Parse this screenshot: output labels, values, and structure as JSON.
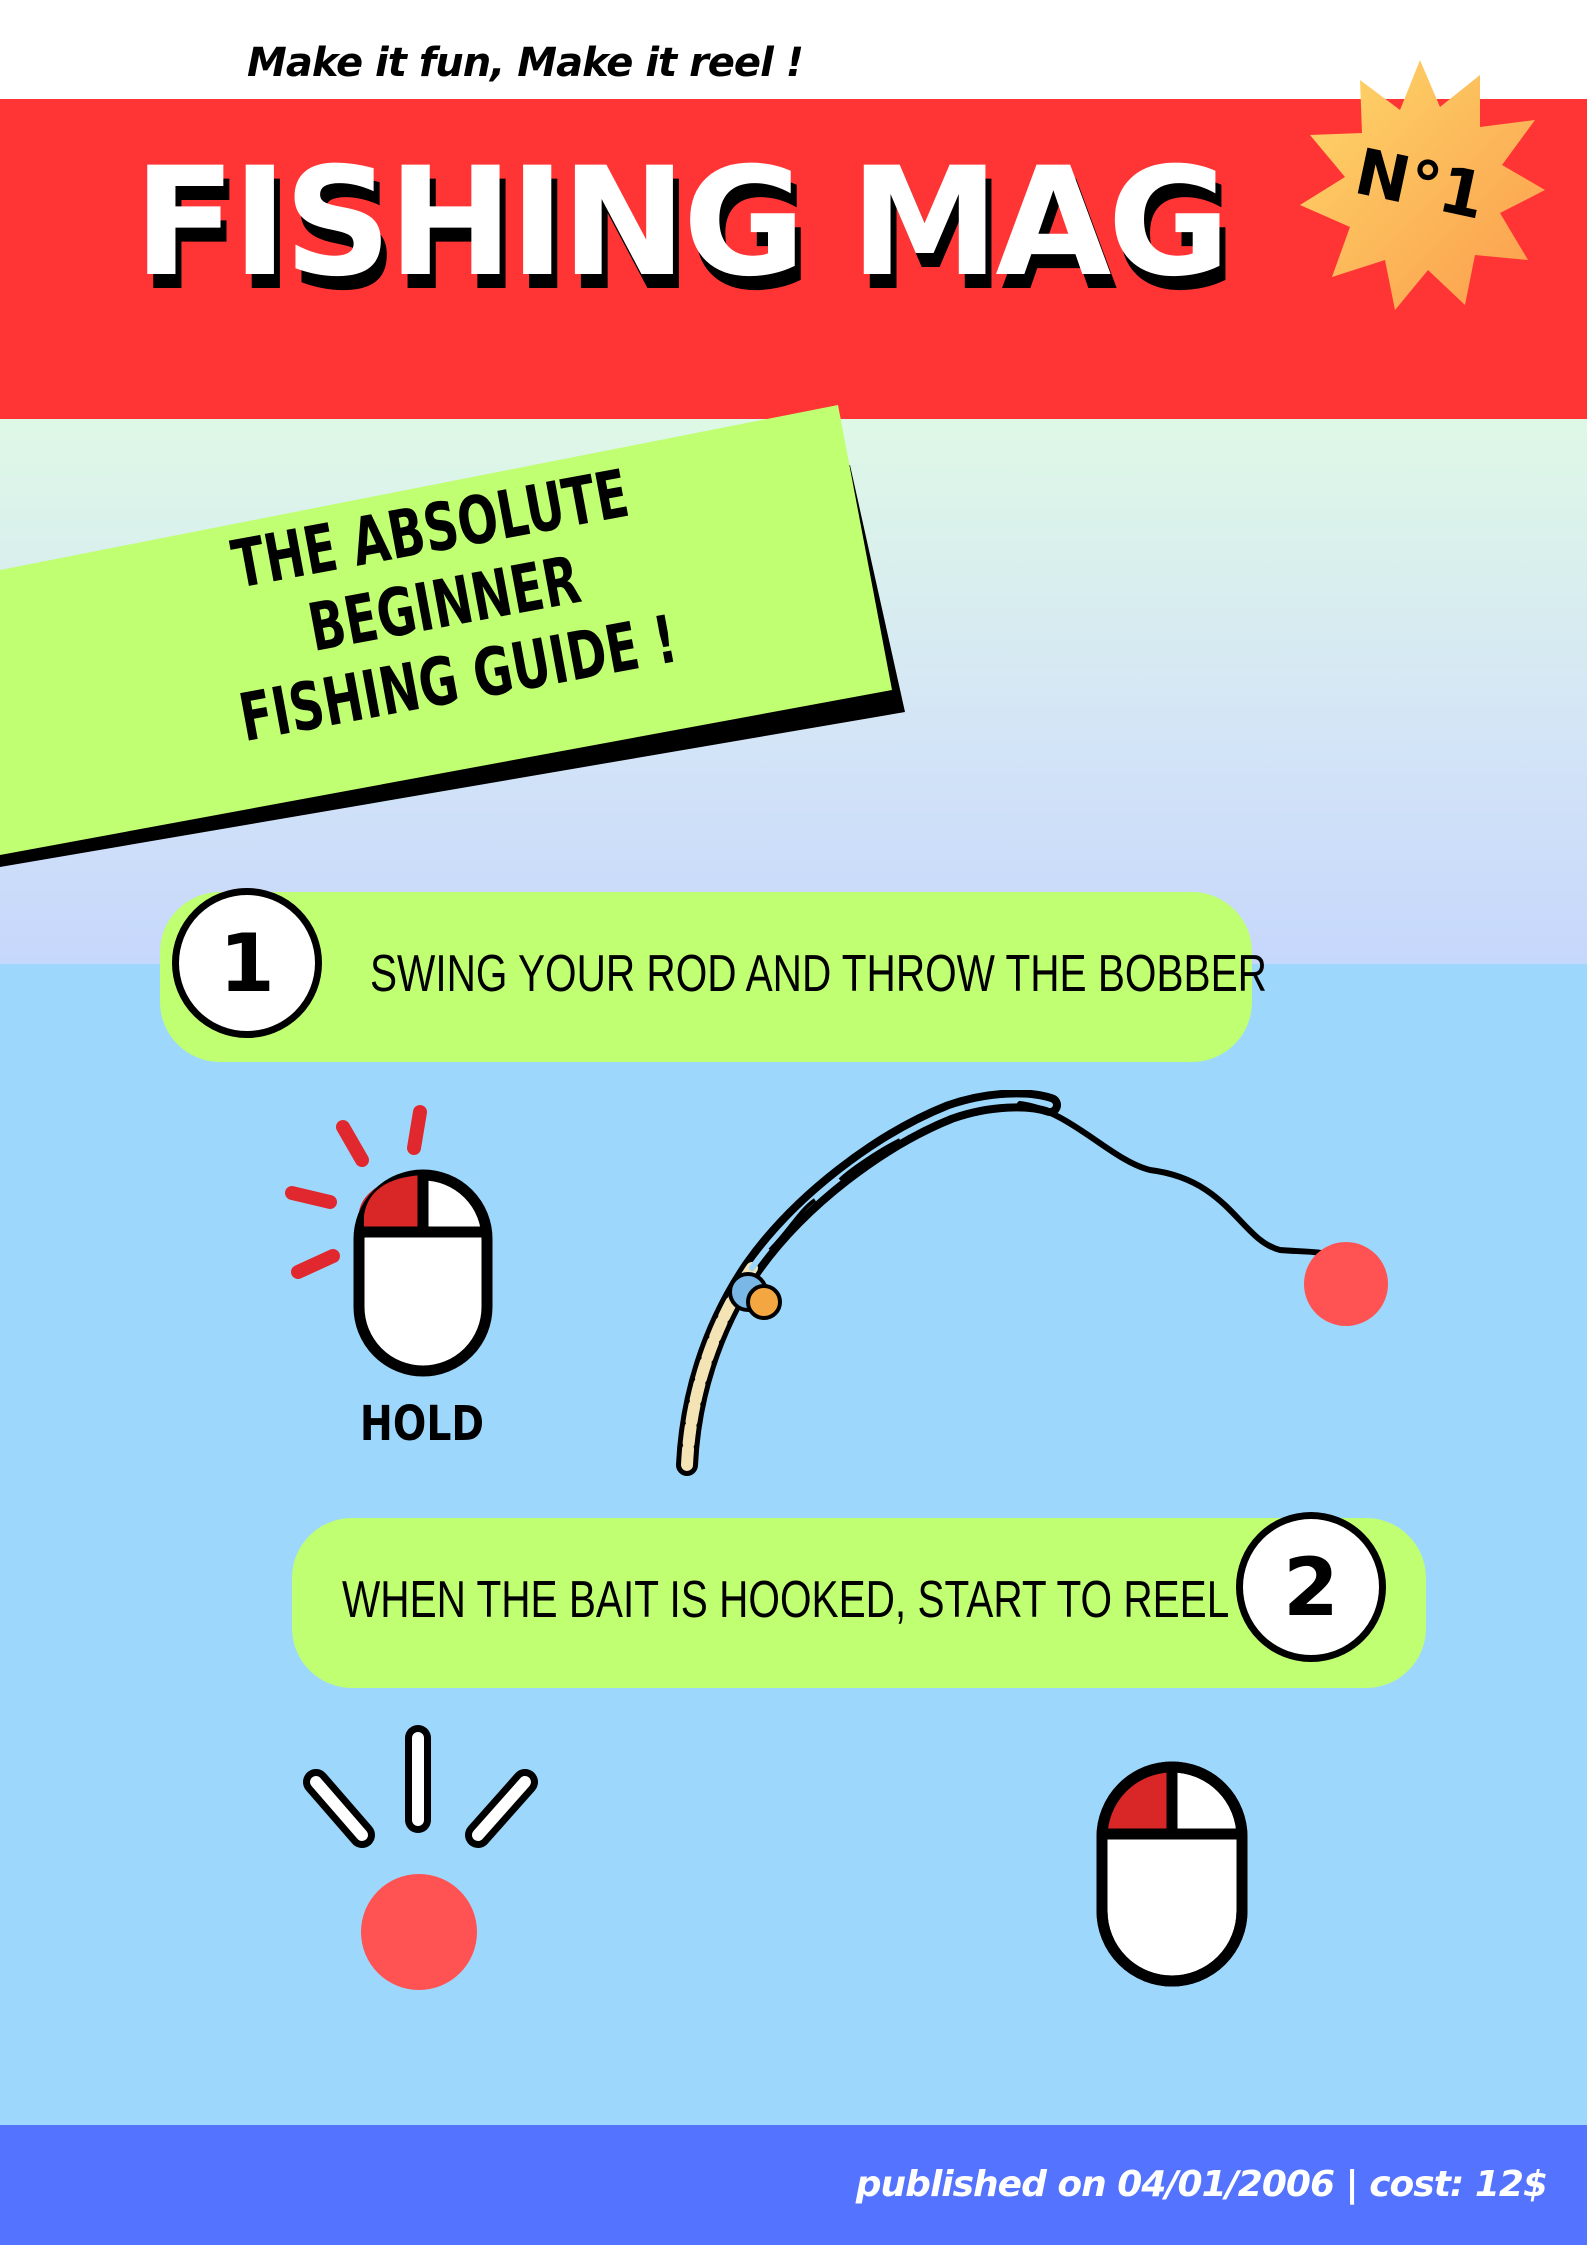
{
  "header": {
    "tagline": "Make it fun,  Make it reel !",
    "title": "FISHING MAG",
    "issue_badge": "N°1"
  },
  "banner": {
    "line1": "THE ABSOLUTE BEGINNER",
    "line2": "FISHING GUIDE !"
  },
  "steps": [
    {
      "number": "1",
      "text": "SWING YOUR ROD AND THROW THE BOBBER"
    },
    {
      "number": "2",
      "text": "WHEN THE BAIT IS HOOKED, START TO REEL !"
    }
  ],
  "hold_label": "HOLD",
  "icons": {
    "mouse_step1": "mouse-left-click-icon",
    "rod": "fishing-rod-icon",
    "bobber": "bobber-icon",
    "mouse_step2": "mouse-left-click-icon"
  },
  "footer": {
    "text": "published on 04/01/2006  |  cost: 12$"
  },
  "colors": {
    "header_red": "#ff3535",
    "banner_green": "#c0fe72",
    "water_blue": "#9dd8fc",
    "footer_blue": "#5473fe",
    "bobber_red": "#ff5252",
    "mouse_red": "#d92626"
  }
}
